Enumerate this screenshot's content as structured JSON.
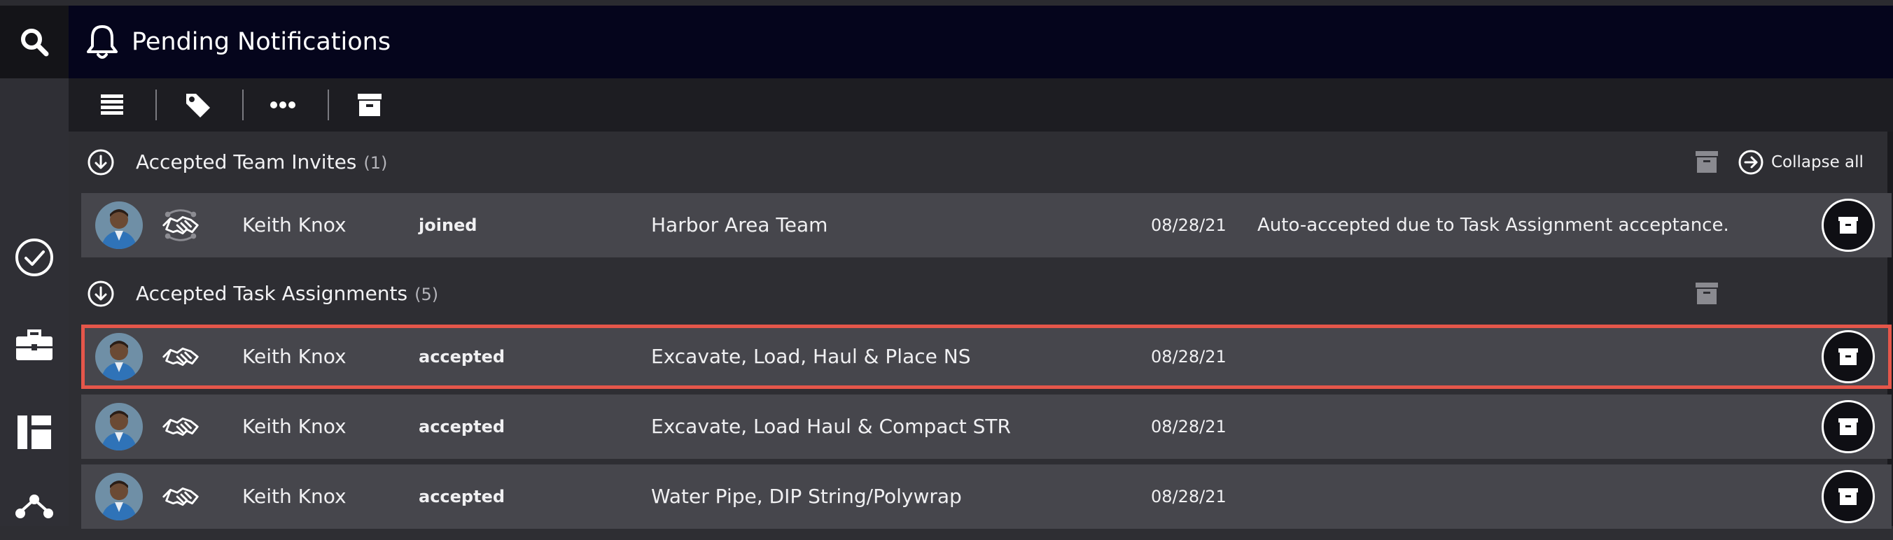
{
  "header": {
    "title": "Pending Notifications"
  },
  "toolbar": {
    "buttons": [
      {
        "icon": "list-icon"
      },
      {
        "icon": "tag-icon"
      },
      {
        "icon": "more-icon"
      },
      {
        "icon": "archive-icon"
      }
    ]
  },
  "sidebar": {
    "items": [
      {
        "icon": "search-icon"
      },
      {
        "icon": "check-circle-icon"
      },
      {
        "icon": "briefcase-icon"
      },
      {
        "icon": "board-icon"
      },
      {
        "icon": "network-icon"
      }
    ]
  },
  "groups": [
    {
      "title": "Accepted Team Invites",
      "count": "(1)",
      "collapse_label": "Collapse all",
      "rows": [
        {
          "name": "Keith Knox",
          "action": "joined",
          "task": "Harbor Area Team",
          "date": "08/28/21",
          "note": "Auto-accepted due to Task Assignment acceptance."
        }
      ]
    },
    {
      "title": "Accepted Task Assignments",
      "count": "(5)",
      "rows": [
        {
          "name": "Keith Knox",
          "action": "accepted",
          "task": "Excavate, Load, Haul & Place NS",
          "date": "08/28/21",
          "note": "",
          "selected": true
        },
        {
          "name": "Keith Knox",
          "action": "accepted",
          "task": "Excavate, Load Haul & Compact STR",
          "date": "08/28/21",
          "note": ""
        },
        {
          "name": "Keith Knox",
          "action": "accepted",
          "task": "Water Pipe, DIP String/Polywrap",
          "date": "08/28/21",
          "note": ""
        }
      ]
    }
  ],
  "colors": {
    "header_bg": "#05051c",
    "toolbar_bg": "#1d1d22",
    "row_bg": "#46464c",
    "selection_border": "#e5564a"
  }
}
